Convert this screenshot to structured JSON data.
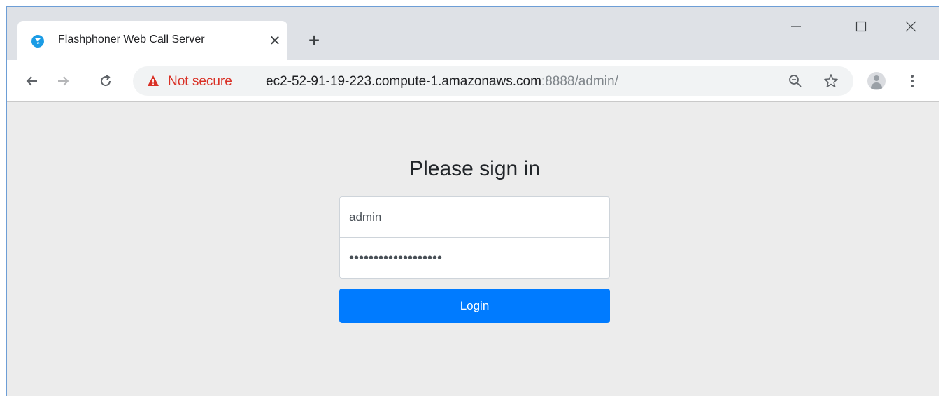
{
  "browser": {
    "tab": {
      "title": "Flashphoner Web Call Server",
      "close_glyph": "✕",
      "favicon": "flashphoner-logo-icon",
      "favicon_color": "#1b9ce5"
    },
    "new_tab_glyph": "+",
    "address_bar": {
      "security_label": "Not secure",
      "security_color": "#d93025",
      "url_host": "ec2-52-91-19-223.compute-1.amazonaws.com",
      "url_rest": ":8888/admin/"
    }
  },
  "page": {
    "heading": "Please sign in",
    "username_value": "admin",
    "password_masked": "•••••••••••••••••••",
    "login_label": "Login",
    "login_color": "#007bff"
  }
}
